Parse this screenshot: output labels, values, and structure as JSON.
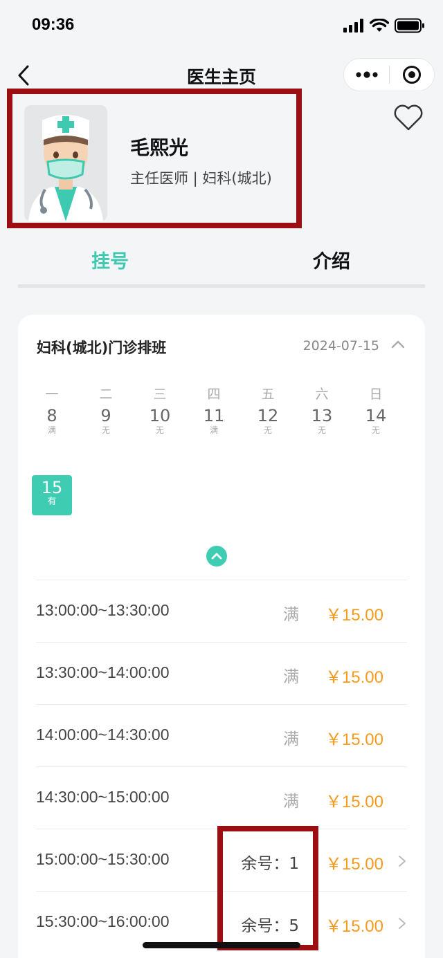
{
  "status_bar": {
    "time": "09:36",
    "icons": [
      "signal-icon",
      "wifi-icon",
      "battery-icon"
    ]
  },
  "nav": {
    "title": "医生主页",
    "icons": [
      "back-icon",
      "more-icon",
      "close-target-icon"
    ]
  },
  "doctor": {
    "name": "毛熙光",
    "title_dept": "主任医师 | 妇科(城北)",
    "favorite_icon": "heart-outline-icon"
  },
  "tabs": [
    {
      "label": "挂号",
      "active": true
    },
    {
      "label": "介绍",
      "active": false
    }
  ],
  "schedule": {
    "title": "妇科(城北)门诊排班",
    "date": "2024-07-15",
    "weekdays": [
      "一",
      "二",
      "三",
      "四",
      "五",
      "六",
      "日"
    ],
    "days": [
      {
        "num": "8",
        "status": "满"
      },
      {
        "num": "9",
        "status": "无"
      },
      {
        "num": "10",
        "status": "无"
      },
      {
        "num": "11",
        "status": "满"
      },
      {
        "num": "12",
        "status": "无"
      },
      {
        "num": "13",
        "status": "无"
      },
      {
        "num": "14",
        "status": "无"
      }
    ],
    "selected_day": {
      "num": "15",
      "status": "有"
    },
    "slots": [
      {
        "time": "13:00:00~13:30:00",
        "status": "满",
        "price": "￥15.00",
        "clickable": false
      },
      {
        "time": "13:30:00~14:00:00",
        "status": "满",
        "price": "￥15.00",
        "clickable": false
      },
      {
        "time": "14:00:00~14:30:00",
        "status": "满",
        "price": "￥15.00",
        "clickable": false
      },
      {
        "time": "14:30:00~15:00:00",
        "status": "满",
        "price": "￥15.00",
        "clickable": false
      },
      {
        "time": "15:00:00~15:30:00",
        "status": "余号：1",
        "price": "￥15.00",
        "clickable": true
      },
      {
        "time": "15:30:00~16:00:00",
        "status": "余号：5",
        "price": "￥15.00",
        "clickable": true
      }
    ]
  },
  "colors": {
    "accent": "#3ecdb3",
    "price": "#f79a1c",
    "highlight_border": "#9b0e12",
    "background": "#f4f5f7"
  }
}
